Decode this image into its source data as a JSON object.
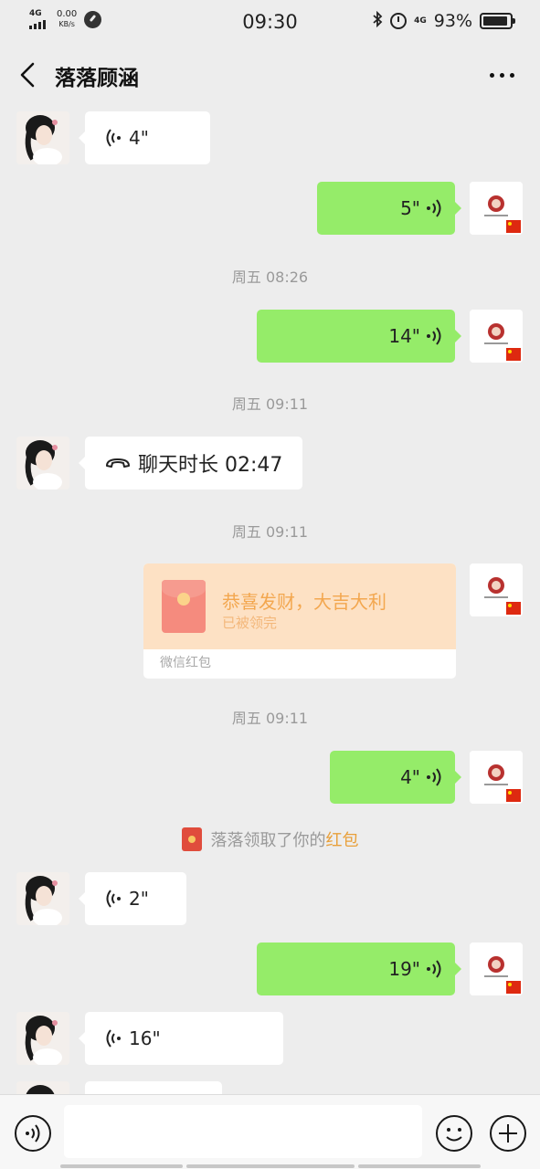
{
  "status_bar": {
    "network": "4G",
    "speed_value": "0.00",
    "speed_unit": "KB/s",
    "time": "09:30",
    "network_right": "4G",
    "battery_percent": "93%",
    "battery_level": 0.93
  },
  "header": {
    "title": "落落顾涵",
    "back_icon": "chevron-left-icon",
    "more_icon": "more-icon"
  },
  "messages": {
    "m1": {
      "side": "in",
      "duration": "4\""
    },
    "m2": {
      "side": "out",
      "duration": "5\""
    },
    "t1": "周五 08:26",
    "m3": {
      "side": "out",
      "duration": "14\""
    },
    "t2": "周五 09:11",
    "m4": {
      "side": "in",
      "call_text": "聊天时长 02:47"
    },
    "t3": "周五 09:11",
    "red_packet": {
      "title": "恭喜发财，大吉大利",
      "status": "已被领完",
      "footer": "微信红包"
    },
    "t4": "周五 09:11",
    "m5": {
      "side": "out",
      "duration": "4\""
    },
    "system": {
      "prefix": "落落领取了你的",
      "highlight": "红包"
    },
    "m6": {
      "side": "in",
      "duration": "2\""
    },
    "m7": {
      "side": "out",
      "duration": "19\""
    },
    "m8": {
      "side": "in",
      "duration": "16\""
    }
  },
  "input_bar": {
    "placeholder": "",
    "voice_icon": "voice-icon",
    "emoji_icon": "emoji-icon",
    "plus_icon": "plus-icon"
  },
  "colors": {
    "background": "#ededed",
    "outgoing_bubble": "#95ec69",
    "incoming_bubble": "#ffffff",
    "red_packet_bg": "#fde1c4",
    "highlight": "#e8a03a"
  }
}
